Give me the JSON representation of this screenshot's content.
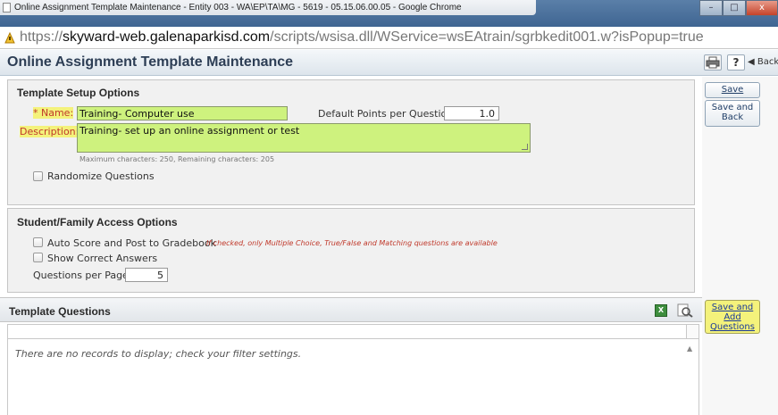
{
  "window": {
    "title": "Online Assignment Template Maintenance - Entity 003 - WA\\EP\\TA\\MG - 5619 - 05.15.06.00.05 - Google Chrome",
    "url_prefix": "https://",
    "url_domain": "skyward-web.galenaparkisd.com",
    "url_path": "/scripts/wsisa.dll/WService=wsEAtrain/sgrbkedit001.w?isPopup=true"
  },
  "header": {
    "title": "Online Assignment Template Maintenance",
    "help_label": "?",
    "back_label": "◀ Back"
  },
  "setup": {
    "title": "Template Setup Options",
    "name_label": "* Name:",
    "name_value": "Training- Computer use",
    "points_label": "Default Points per Question:",
    "points_value": "1.0",
    "description_label": "Description:",
    "description_value": "Training- set up an online assignment or test",
    "char_note": "Maximum characters: 250, Remaining characters: 205",
    "randomize_label": "Randomize Questions"
  },
  "access": {
    "title": "Student/Family Access Options",
    "auto_score_label": "Auto Score and Post to Gradebook",
    "auto_score_note": "If checked, only Multiple Choice, True/False and Matching questions are available",
    "show_answers_label": "Show Correct Answers",
    "qpp_label": "Questions per Page:",
    "qpp_value": "5"
  },
  "questions": {
    "title": "Template Questions",
    "empty_message": "There are no records to display; check your filter settings."
  },
  "side_buttons": {
    "save": "Save",
    "save_back": "Save and Back",
    "save_add": "Save and Add Questions"
  },
  "colors": {
    "highlight": "#f4f27b",
    "input_fill": "#cef27e",
    "note_red": "#c0392b"
  }
}
